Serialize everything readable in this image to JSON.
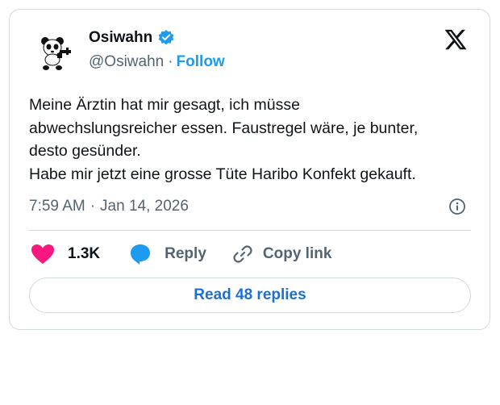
{
  "author": {
    "display_name": "Osiwahn",
    "handle": "@Osiwahn",
    "separator": "·",
    "follow_label": "Follow",
    "verified_icon": "verified-badge-icon",
    "avatar_icon": "panda-avatar"
  },
  "tweet": {
    "text": "Meine Ärztin hat mir gesagt, ich müsse\nabwechslungsreicher essen. Faustregel wäre, je bunter,\ndesto gesünder.\nHabe mir jetzt eine grosse Tüte Haribo Konfekt gekauft.",
    "time": "7:59 AM",
    "separator": "·",
    "date": "Jan 14, 2026"
  },
  "actions": {
    "likes_count": "1.3K",
    "reply_label": "Reply",
    "copy_link_label": "Copy link"
  },
  "read_replies_label": "Read 48 replies",
  "colors": {
    "accent": "#1d9bf0",
    "heart": "#f91880",
    "reply_bubble": "#1d9bf0",
    "border": "#cfd9de",
    "muted_text": "#536471"
  }
}
